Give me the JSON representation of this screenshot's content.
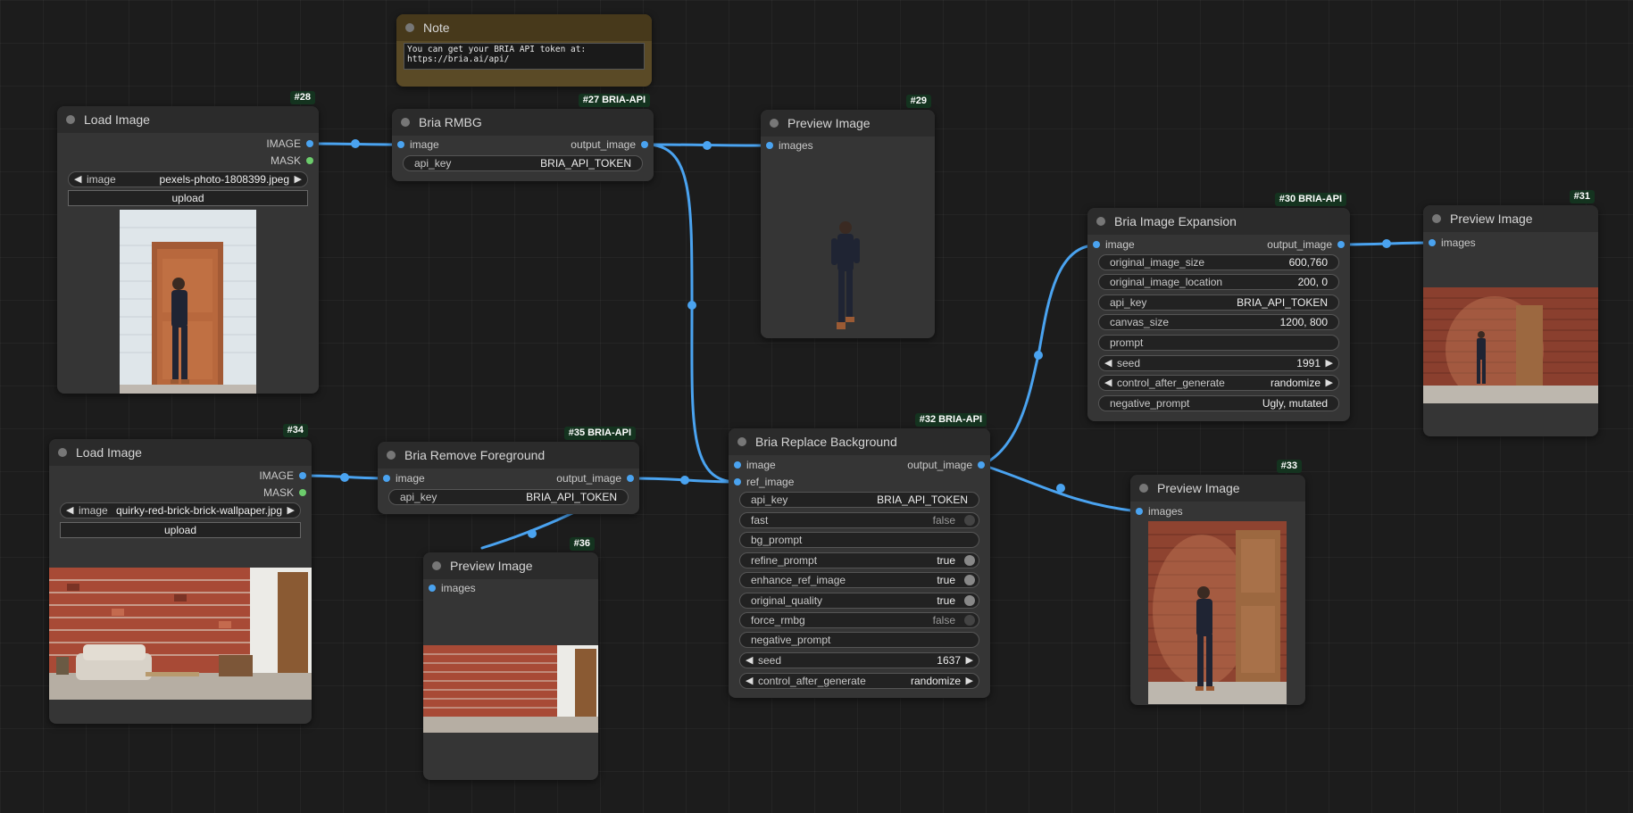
{
  "note": {
    "title": "Note",
    "text": "You can get your BRIA API token at:\nhttps://bria.ai/api/"
  },
  "node28": {
    "badge": "#28",
    "title": "Load Image",
    "out_image": "IMAGE",
    "out_mask": "MASK",
    "image_label": "image",
    "image_value": "pexels-photo-1808399.jpeg",
    "upload": "upload"
  },
  "node34": {
    "badge": "#34",
    "title": "Load Image",
    "out_image": "IMAGE",
    "out_mask": "MASK",
    "image_label": "image",
    "image_value": "quirky-red-brick-brick-wallpaper.jpg",
    "upload": "upload"
  },
  "node27": {
    "badge": "#27 BRIA-API",
    "title": "Bria RMBG",
    "in_image": "image",
    "out_image": "output_image",
    "api_key_label": "api_key",
    "api_key_value": "BRIA_API_TOKEN"
  },
  "node35": {
    "badge": "#35 BRIA-API",
    "title": "Bria Remove Foreground",
    "in_image": "image",
    "out_image": "output_image",
    "api_key_label": "api_key",
    "api_key_value": "BRIA_API_TOKEN"
  },
  "node29": {
    "badge": "#29",
    "title": "Preview Image",
    "in_images": "images"
  },
  "node36": {
    "badge": "#36",
    "title": "Preview Image",
    "in_images": "images"
  },
  "node31": {
    "badge": "#31",
    "title": "Preview Image",
    "in_images": "images"
  },
  "node33": {
    "badge": "#33",
    "title": "Preview Image",
    "in_images": "images"
  },
  "node32": {
    "badge": "#32 BRIA-API",
    "title": "Bria Replace Background",
    "in_image": "image",
    "in_ref_image": "ref_image",
    "out_image": "output_image",
    "widgets": [
      {
        "label": "api_key",
        "value": "BRIA_API_TOKEN"
      },
      {
        "label": "fast",
        "value": "false"
      },
      {
        "label": "bg_prompt",
        "value": ""
      },
      {
        "label": "refine_prompt",
        "value": "true"
      },
      {
        "label": "enhance_ref_image",
        "value": "true"
      },
      {
        "label": "original_quality",
        "value": "true"
      },
      {
        "label": "force_rmbg",
        "value": "false"
      },
      {
        "label": "negative_prompt",
        "value": ""
      },
      {
        "label": "seed",
        "value": "1637"
      },
      {
        "label": "control_after_generate",
        "value": "randomize"
      }
    ]
  },
  "node30": {
    "badge": "#30 BRIA-API",
    "title": "Bria Image Expansion",
    "in_image": "image",
    "out_image": "output_image",
    "widgets": [
      {
        "label": "original_image_size",
        "value": "600,760"
      },
      {
        "label": "original_image_location",
        "value": "200, 0"
      },
      {
        "label": "api_key",
        "value": "BRIA_API_TOKEN"
      },
      {
        "label": "canvas_size",
        "value": "1200, 800"
      },
      {
        "label": "prompt",
        "value": ""
      },
      {
        "label": "seed",
        "value": "1991"
      },
      {
        "label": "control_after_generate",
        "value": "randomize"
      },
      {
        "label": "negative_prompt",
        "value": "Ugly, mutated"
      }
    ]
  },
  "colors": {
    "canvas": "#1c1c1c",
    "node": "#353535",
    "node_header": "#2b2b2b",
    "note": "#5a4a26",
    "wire": "#4aa3f0",
    "mask_pin": "#6ccc6c",
    "badge": "#14331f"
  }
}
